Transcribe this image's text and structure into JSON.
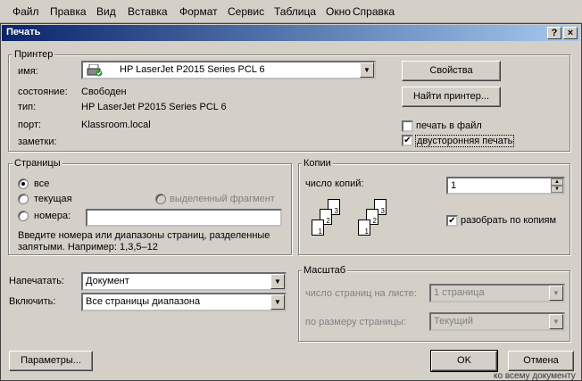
{
  "menubar": {
    "items": [
      "Файл",
      "Правка",
      "Вид",
      "Вставка",
      "Формат",
      "Сервис",
      "Таблица",
      "Окно",
      "Справка"
    ]
  },
  "dialog": {
    "title": "Печать",
    "help_label": "?",
    "close_label": "×",
    "printer": {
      "legend": "Принтер",
      "name_label": "имя:",
      "name_value": "HP LaserJet P2015 Series PCL 6",
      "status_label": "состояние:",
      "status_value": "Свободен",
      "type_label": "тип:",
      "type_value": "HP LaserJet P2015 Series PCL 6",
      "port_label": "порт:",
      "port_value": "Klassroom.local",
      "notes_label": "заметки:",
      "notes_value": "",
      "properties_button": "Свойства",
      "find_button": "Найти принтер...",
      "print_to_file": {
        "label": "печать в файл",
        "checked": false
      },
      "duplex": {
        "label": "двусторонняя печать",
        "checked": true
      }
    },
    "pages": {
      "legend": "Страницы",
      "all": "все",
      "current": "текущая",
      "selection": "выделенный фрагмент",
      "numbers": "номера:",
      "numbers_value": "",
      "selected": "all",
      "hint": "Введите номера или диапазоны страниц, разделенные запятыми. Например: 1,3,5–12"
    },
    "copies": {
      "legend": "Копии",
      "count_label": "число копий:",
      "count_value": "1",
      "collate": {
        "label": "разобрать по копиям",
        "checked": true
      },
      "stack_numbers": [
        "1",
        "2",
        "3"
      ]
    },
    "print_what": {
      "label": "Напечатать:",
      "value": "Документ"
    },
    "include": {
      "label": "Включить:",
      "value": "Все страницы диапазона"
    },
    "zoom": {
      "legend": "Масштаб",
      "pages_per_sheet_label": "число страниц на листе:",
      "pages_per_sheet_value": "1 страница",
      "scale_label": "по размеру страницы:",
      "scale_value": "Текущий"
    },
    "options_button": "Параметры...",
    "ok_button": "OK",
    "cancel_button": "Отмена"
  },
  "background_text": "ко всему документу",
  "colors": {
    "title_start": "#0a246a",
    "title_end": "#a6caf0",
    "face": "#d4d0c8"
  },
  "icons": [
    "printer-icon",
    "checkmark-icon",
    "dropdown-arrow-icon",
    "spin-up-icon",
    "spin-down-icon"
  ]
}
